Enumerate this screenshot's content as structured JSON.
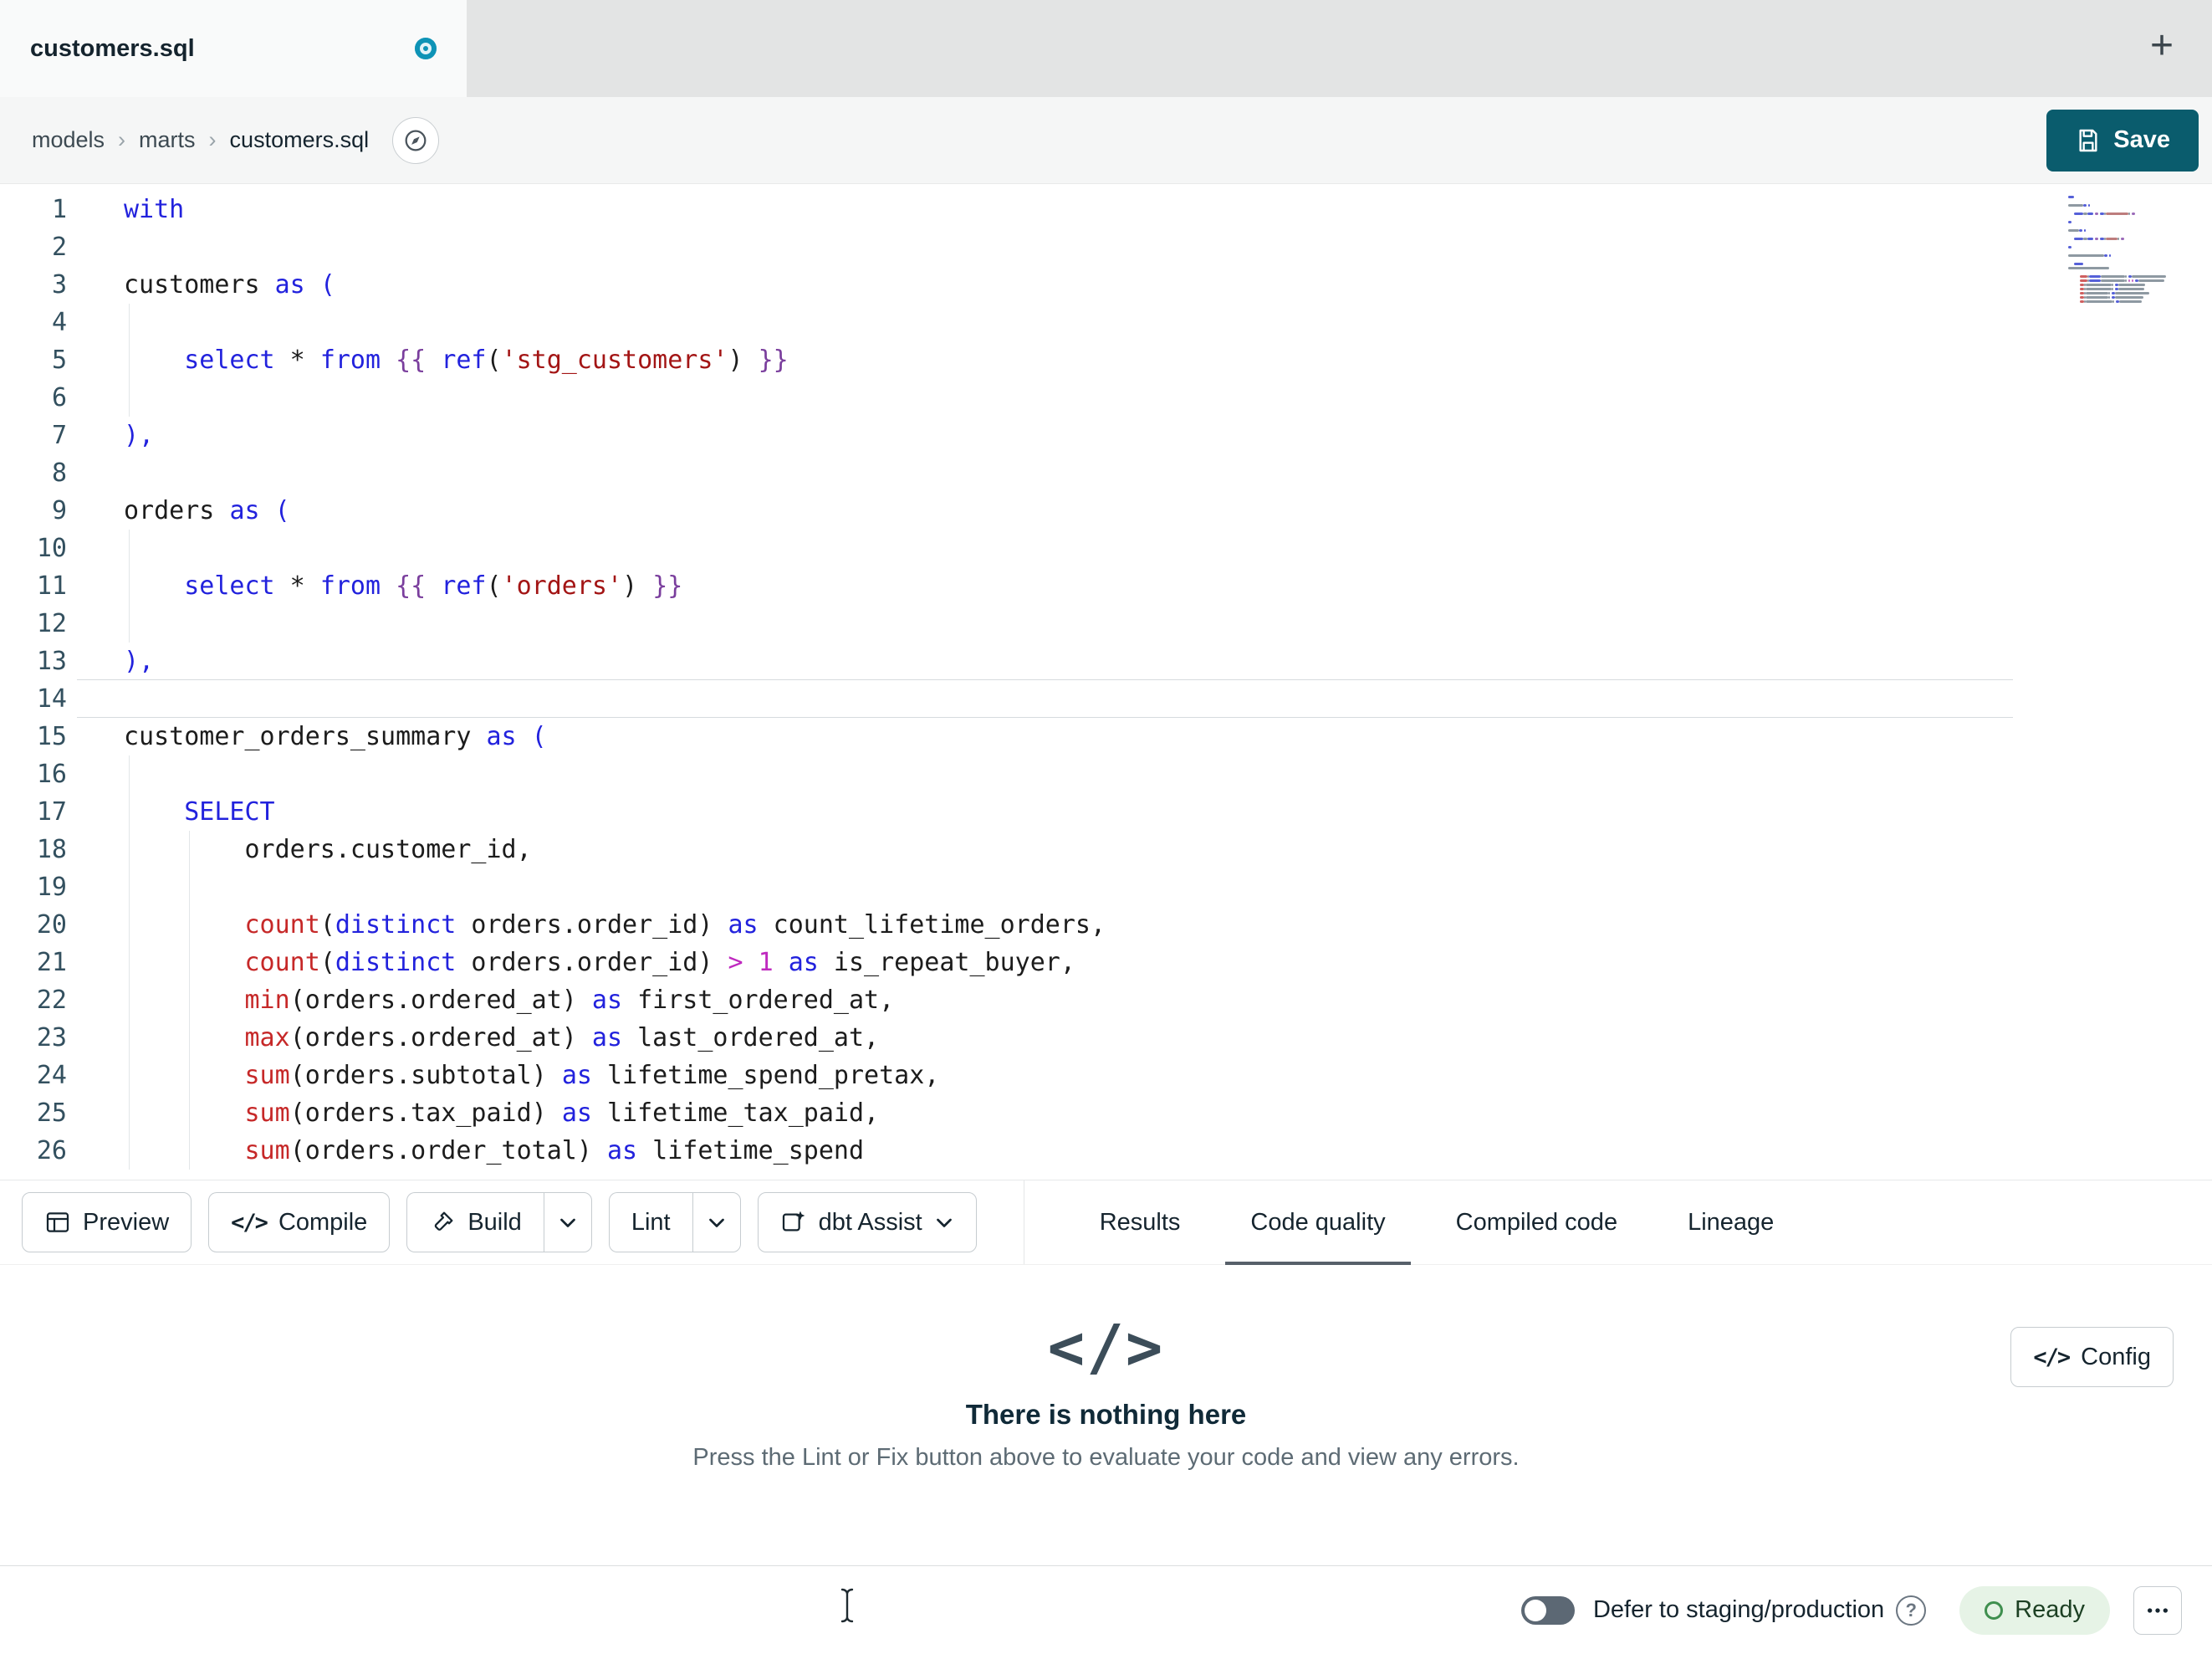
{
  "tab_bar": {
    "active_tab": "customers.sql",
    "has_unsaved_changes": true
  },
  "breadcrumb": {
    "items": [
      "models",
      "marts",
      "customers.sql"
    ],
    "separator": "›"
  },
  "header": {
    "save_label": "Save"
  },
  "icons": {
    "code_glyph": "</>",
    "plus": "+",
    "help": "?"
  },
  "editor": {
    "language": "sql",
    "current_line": 14,
    "lines": [
      {
        "n": 1,
        "segs": [
          [
            "with",
            "k"
          ]
        ]
      },
      {
        "n": 2,
        "segs": []
      },
      {
        "n": 3,
        "segs": [
          [
            "customers ",
            "p"
          ],
          [
            "as",
            "k"
          ],
          [
            " ",
            "p"
          ],
          [
            "(",
            "k"
          ]
        ]
      },
      {
        "n": 4,
        "segs": []
      },
      {
        "n": 5,
        "segs": [
          [
            "    ",
            "p"
          ],
          [
            "select",
            "k"
          ],
          [
            " * ",
            "p"
          ],
          [
            "from",
            "k"
          ],
          [
            " ",
            "p"
          ],
          [
            "{{",
            "j"
          ],
          [
            " ",
            "p"
          ],
          [
            "ref",
            "k"
          ],
          [
            "(",
            "p"
          ],
          [
            "'stg_customers'",
            "s"
          ],
          [
            ")",
            "p"
          ],
          [
            " ",
            "p"
          ],
          [
            "}}",
            "j"
          ]
        ]
      },
      {
        "n": 6,
        "segs": []
      },
      {
        "n": 7,
        "segs": [
          [
            "),",
            "k"
          ]
        ]
      },
      {
        "n": 8,
        "segs": []
      },
      {
        "n": 9,
        "segs": [
          [
            "orders ",
            "p"
          ],
          [
            "as",
            "k"
          ],
          [
            " ",
            "p"
          ],
          [
            "(",
            "k"
          ]
        ]
      },
      {
        "n": 10,
        "segs": []
      },
      {
        "n": 11,
        "segs": [
          [
            "    ",
            "p"
          ],
          [
            "select",
            "k"
          ],
          [
            " * ",
            "p"
          ],
          [
            "from",
            "k"
          ],
          [
            " ",
            "p"
          ],
          [
            "{{",
            "j"
          ],
          [
            " ",
            "p"
          ],
          [
            "ref",
            "k"
          ],
          [
            "(",
            "p"
          ],
          [
            "'orders'",
            "s"
          ],
          [
            ")",
            "p"
          ],
          [
            " ",
            "p"
          ],
          [
            "}}",
            "j"
          ]
        ]
      },
      {
        "n": 12,
        "segs": []
      },
      {
        "n": 13,
        "segs": [
          [
            "),",
            "k"
          ]
        ]
      },
      {
        "n": 14,
        "segs": []
      },
      {
        "n": 15,
        "segs": [
          [
            "customer_orders_summary ",
            "p"
          ],
          [
            "as",
            "k"
          ],
          [
            " ",
            "p"
          ],
          [
            "(",
            "k"
          ]
        ]
      },
      {
        "n": 16,
        "segs": []
      },
      {
        "n": 17,
        "segs": [
          [
            "    ",
            "p"
          ],
          [
            "SELECT",
            "k"
          ]
        ]
      },
      {
        "n": 18,
        "segs": [
          [
            "        orders.customer_id,",
            "p"
          ]
        ]
      },
      {
        "n": 19,
        "segs": []
      },
      {
        "n": 20,
        "segs": [
          [
            "        ",
            "p"
          ],
          [
            "count",
            "f"
          ],
          [
            "(",
            "p"
          ],
          [
            "distinct",
            "k"
          ],
          [
            " orders.order_id",
            "p"
          ],
          [
            ")",
            "p"
          ],
          [
            " ",
            "p"
          ],
          [
            "as",
            "k"
          ],
          [
            " count_lifetime_orders,",
            "p"
          ]
        ]
      },
      {
        "n": 21,
        "segs": [
          [
            "        ",
            "p"
          ],
          [
            "count",
            "f"
          ],
          [
            "(",
            "p"
          ],
          [
            "distinct",
            "k"
          ],
          [
            " orders.order_id",
            "p"
          ],
          [
            ")",
            "p"
          ],
          [
            " ",
            "p"
          ],
          [
            ">",
            "n"
          ],
          [
            " ",
            "p"
          ],
          [
            "1",
            "n"
          ],
          [
            " ",
            "p"
          ],
          [
            "as",
            "k"
          ],
          [
            " is_repeat_buyer,",
            "p"
          ]
        ]
      },
      {
        "n": 22,
        "segs": [
          [
            "        ",
            "p"
          ],
          [
            "min",
            "f"
          ],
          [
            "(",
            "p"
          ],
          [
            "orders.ordered_at",
            "p"
          ],
          [
            ")",
            "p"
          ],
          [
            " ",
            "p"
          ],
          [
            "as",
            "k"
          ],
          [
            " first_ordered_at,",
            "p"
          ]
        ]
      },
      {
        "n": 23,
        "segs": [
          [
            "        ",
            "p"
          ],
          [
            "max",
            "f"
          ],
          [
            "(",
            "p"
          ],
          [
            "orders.ordered_at",
            "p"
          ],
          [
            ")",
            "p"
          ],
          [
            " ",
            "p"
          ],
          [
            "as",
            "k"
          ],
          [
            " last_ordered_at,",
            "p"
          ]
        ]
      },
      {
        "n": 24,
        "segs": [
          [
            "        ",
            "p"
          ],
          [
            "sum",
            "f"
          ],
          [
            "(",
            "p"
          ],
          [
            "orders.subtotal",
            "p"
          ],
          [
            ")",
            "p"
          ],
          [
            " ",
            "p"
          ],
          [
            "as",
            "k"
          ],
          [
            " lifetime_spend_pretax,",
            "p"
          ]
        ]
      },
      {
        "n": 25,
        "segs": [
          [
            "        ",
            "p"
          ],
          [
            "sum",
            "f"
          ],
          [
            "(",
            "p"
          ],
          [
            "orders.tax_paid",
            "p"
          ],
          [
            ")",
            "p"
          ],
          [
            " ",
            "p"
          ],
          [
            "as",
            "k"
          ],
          [
            " lifetime_tax_paid,",
            "p"
          ]
        ]
      },
      {
        "n": 26,
        "segs": [
          [
            "        ",
            "p"
          ],
          [
            "sum",
            "f"
          ],
          [
            "(",
            "p"
          ],
          [
            "orders.order_total",
            "p"
          ],
          [
            ")",
            "p"
          ],
          [
            " ",
            "p"
          ],
          [
            "as",
            "k"
          ],
          [
            " lifetime_spend",
            "p"
          ]
        ]
      }
    ],
    "guides": [
      {
        "col": 0,
        "from": 4,
        "to": 6
      },
      {
        "col": 0,
        "from": 10,
        "to": 12
      },
      {
        "col": 0,
        "from": 16,
        "to": 26
      },
      {
        "col": 4,
        "from": 18,
        "to": 26
      }
    ]
  },
  "toolbar": {
    "preview_label": "Preview",
    "compile_label": "Compile",
    "build_label": "Build",
    "lint_label": "Lint",
    "assist_label": "dbt Assist"
  },
  "panel_tabs": [
    {
      "label": "Results",
      "active": false
    },
    {
      "label": "Code quality",
      "active": true
    },
    {
      "label": "Compiled code",
      "active": false
    },
    {
      "label": "Lineage",
      "active": false
    }
  ],
  "empty_state": {
    "icon": "</>",
    "title": "There is nothing here",
    "subtitle": "Press the Lint or Fix button above to evaluate your code and view any errors."
  },
  "config_button": {
    "label": "Config"
  },
  "status_bar": {
    "defer_label": "Defer to staging/production",
    "defer_enabled": false,
    "ready_label": "Ready"
  },
  "colors": {
    "accent_teal": "#0a5c6d",
    "tab_dot": "#0e93b6",
    "keyword": "#2222dd",
    "function": "#c62828",
    "string": "#a31515",
    "number_operator": "#bf29bf",
    "jinja": "#7a3e9d",
    "ready_bg": "#e6f3e6",
    "ready_ring": "#3f8f4f"
  }
}
